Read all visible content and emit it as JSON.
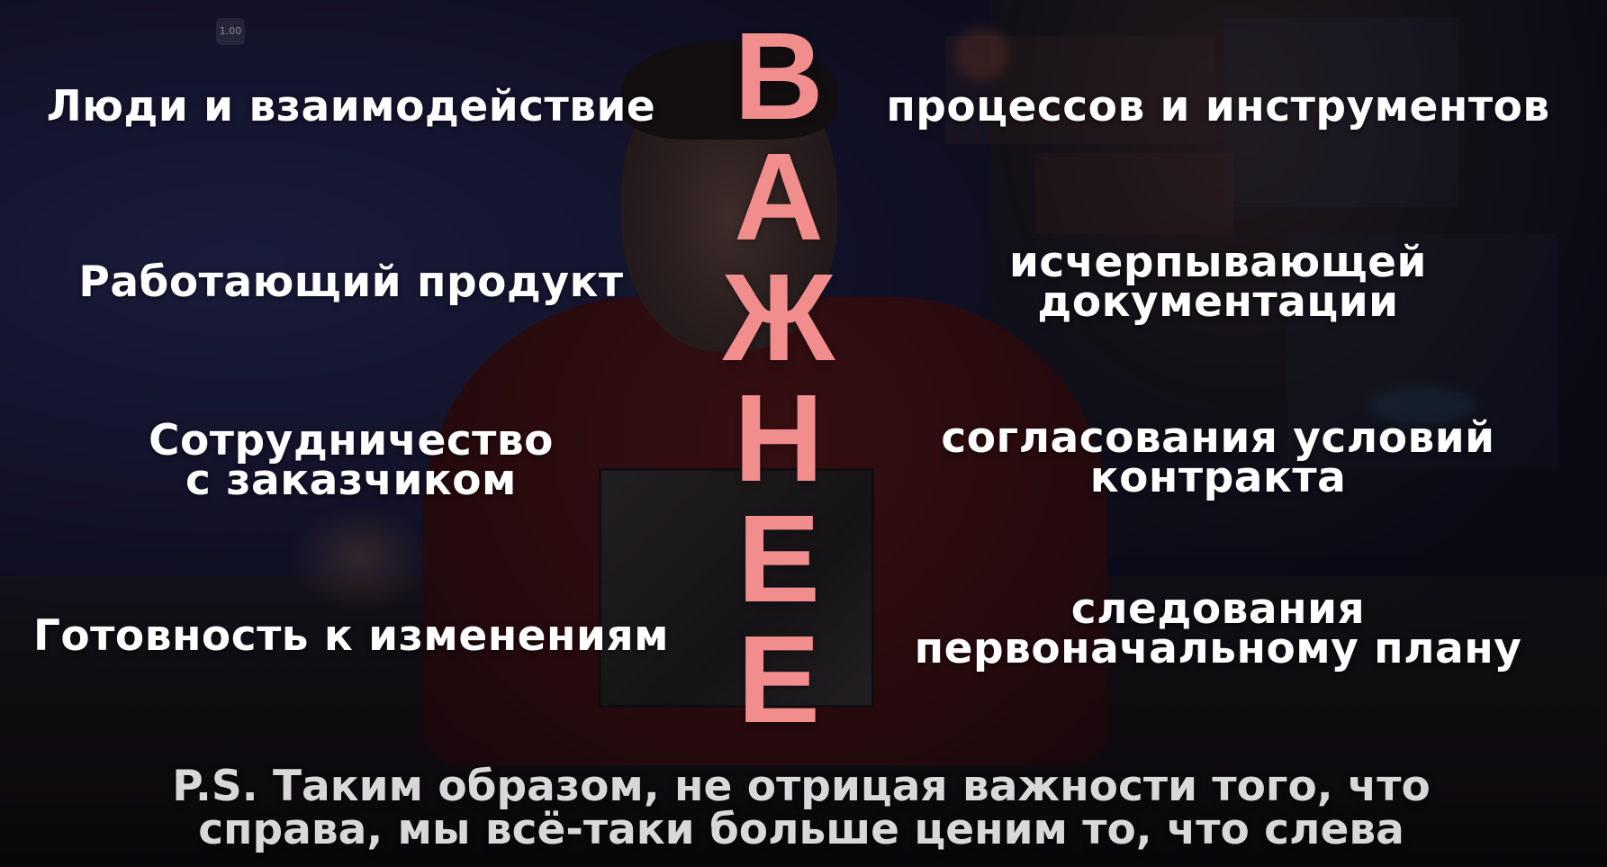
{
  "player": {
    "speed_badge": "1.00"
  },
  "slide": {
    "center_word_letters": [
      "В",
      "А",
      "Ж",
      "Н",
      "Е",
      "Е"
    ],
    "accent_color": "#f28d8d",
    "rows": [
      {
        "left": [
          "Люди и взаимодействие"
        ],
        "right": [
          "процессов и инструментов"
        ]
      },
      {
        "left": [
          "Работающий продукт"
        ],
        "right": [
          "исчерпывающей",
          "документации"
        ]
      },
      {
        "left": [
          "Сотрудничество",
          "с заказчиком"
        ],
        "right": [
          "согласования условий",
          "контракта"
        ]
      },
      {
        "left": [
          "Готовность к изменениям"
        ],
        "right": [
          "следования",
          "первоначальному плану"
        ]
      }
    ],
    "postscript": [
      "P.S. Таким образом, не отрицая важности того, что",
      "справа, мы всё-таки больше ценим то, что слева"
    ]
  }
}
